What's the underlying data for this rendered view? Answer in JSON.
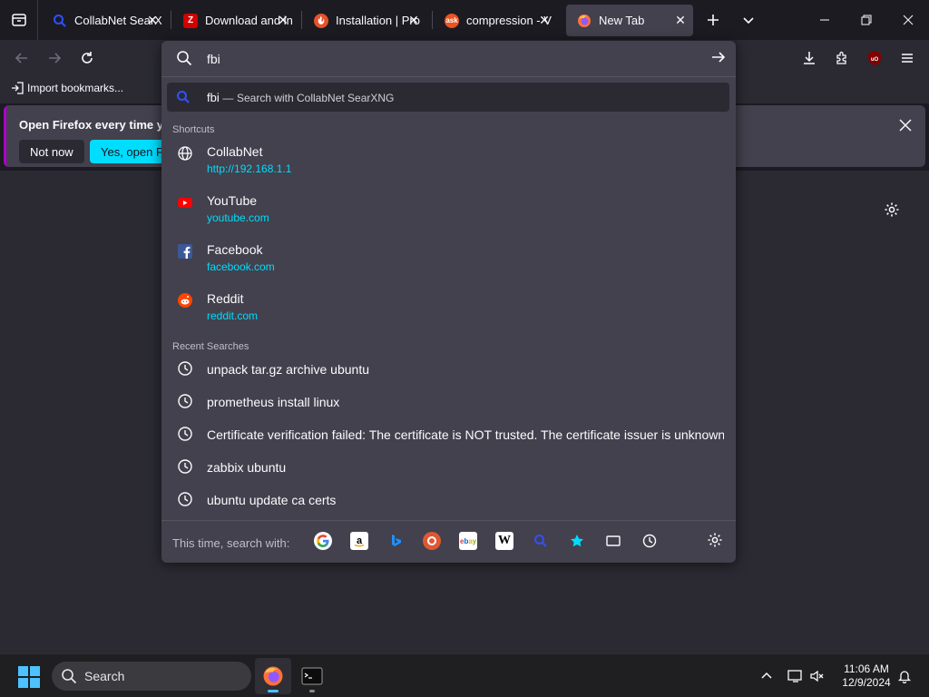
{
  "tabs": [
    {
      "title": "CollabNet SearX",
      "favicon": "searxng-icon",
      "color": "#3050ff",
      "active": false
    },
    {
      "title": "Download and in",
      "favicon": "zabbix-icon",
      "color": "#d40000",
      "active": false
    },
    {
      "title": "Installation | Pro",
      "favicon": "prometheus-icon",
      "color": "#e6522c",
      "active": false
    },
    {
      "title": "compression - V",
      "favicon": "askubuntu-icon",
      "color": "#e95420",
      "active": false
    },
    {
      "title": "New Tab",
      "favicon": "firefox-icon",
      "color": "#ff7139",
      "active": true
    }
  ],
  "bookmarks": {
    "import_label": "Import bookmarks..."
  },
  "notification": {
    "text": "Open Firefox every time you",
    "not_now": "Not now",
    "yes_open": "Yes, open Fire"
  },
  "urlbar": {
    "query": "fbi",
    "suggestion_query": "fbi",
    "suggestion_sep": "—",
    "suggestion_action": "Search with CollabNet SearXNG",
    "shortcuts_label": "Shortcuts",
    "shortcuts": [
      {
        "title": "CollabNet",
        "url": "http://192.168.1.1",
        "icon": "globe-icon"
      },
      {
        "title": "YouTube",
        "url": "youtube.com",
        "icon": "youtube-icon"
      },
      {
        "title": "Facebook",
        "url": "facebook.com",
        "icon": "facebook-icon"
      },
      {
        "title": "Reddit",
        "url": "reddit.com",
        "icon": "reddit-icon"
      }
    ],
    "recent_label": "Recent Searches",
    "recent": [
      "unpack tar.gz archive ubuntu",
      "prometheus install linux",
      "Certificate verification failed: The certificate is NOT trusted. The certificate issuer is unknown. C",
      "zabbix ubuntu",
      "ubuntu update ca certs"
    ],
    "oneoff_label": "This time, search with:",
    "engines": [
      "google-icon",
      "amazon-icon",
      "bing-icon",
      "duckduckgo-icon",
      "ebay-icon",
      "wikipedia-icon",
      "searxng-icon",
      "bookmarks-icon",
      "tabs-icon",
      "history-icon"
    ]
  },
  "taskbar": {
    "search_label": "Search",
    "time": "11:06 AM",
    "date": "12/9/2024"
  },
  "colors": {
    "accent": "#00ddff",
    "windows_accent": "#4cc2ff"
  }
}
